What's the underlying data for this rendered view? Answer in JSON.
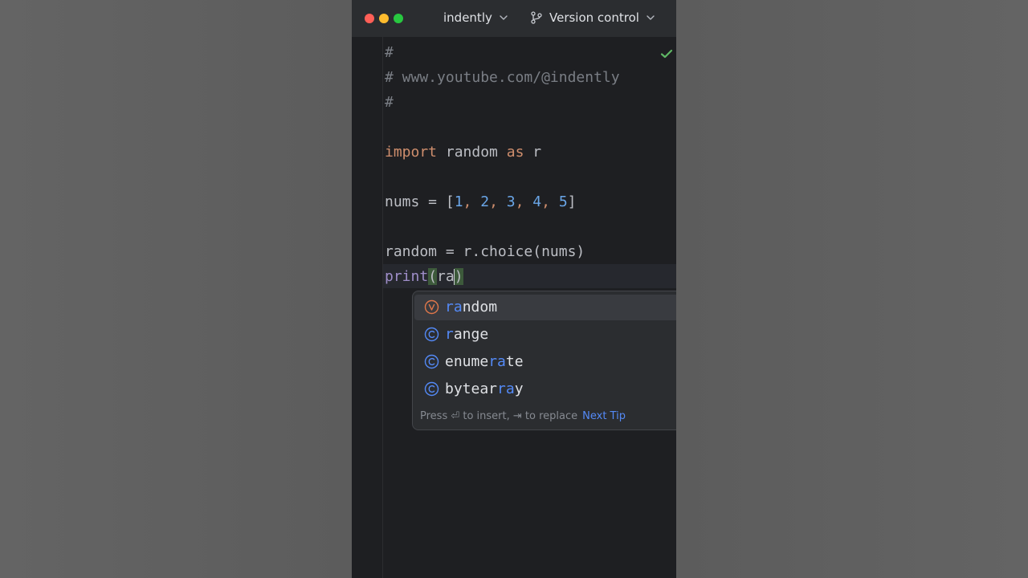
{
  "titlebar": {
    "project_name": "indently",
    "vcs_label": "Version control"
  },
  "editor": {
    "lines": {
      "l1": "#",
      "l2": "# www.youtube.com/@indently",
      "l3": "#",
      "import_kw": "import",
      "import_mod": " random ",
      "as_kw": "as",
      "import_alias": " r",
      "nums_lhs": "nums = [",
      "n1": "1",
      "n2": "2",
      "n3": "3",
      "n4": "4",
      "n5": "5",
      "comma": ", ",
      "nums_rhs": "]",
      "choice_line": "random = r.choice(nums)",
      "print_fn": "print",
      "open_paren": "(",
      "typed": "ra",
      "close_paren": ")"
    }
  },
  "completion": {
    "items": [
      {
        "kind": "variable",
        "prefix": "",
        "match": "ra",
        "suffix": "ndom"
      },
      {
        "kind": "class",
        "prefix": "",
        "match": "r",
        "suffix": "ange"
      },
      {
        "kind": "class",
        "prefix": "enume",
        "match": "ra",
        "suffix": "te"
      },
      {
        "kind": "class",
        "prefix": "bytear",
        "match": "ra",
        "suffix": "y"
      }
    ],
    "hint_text": "Press ⏎ to insert, ⇥ to replace",
    "next_tip": "Next Tip"
  },
  "colors": {
    "keyword": "#cf8e6d",
    "number": "#6aa6e8",
    "function": "#9f8ec9",
    "comment": "#7a7e85",
    "match": "#548af7"
  },
  "icons": [
    "chevron-down-icon",
    "branch-icon",
    "inspection-ok-icon",
    "variable-icon",
    "class-icon"
  ]
}
